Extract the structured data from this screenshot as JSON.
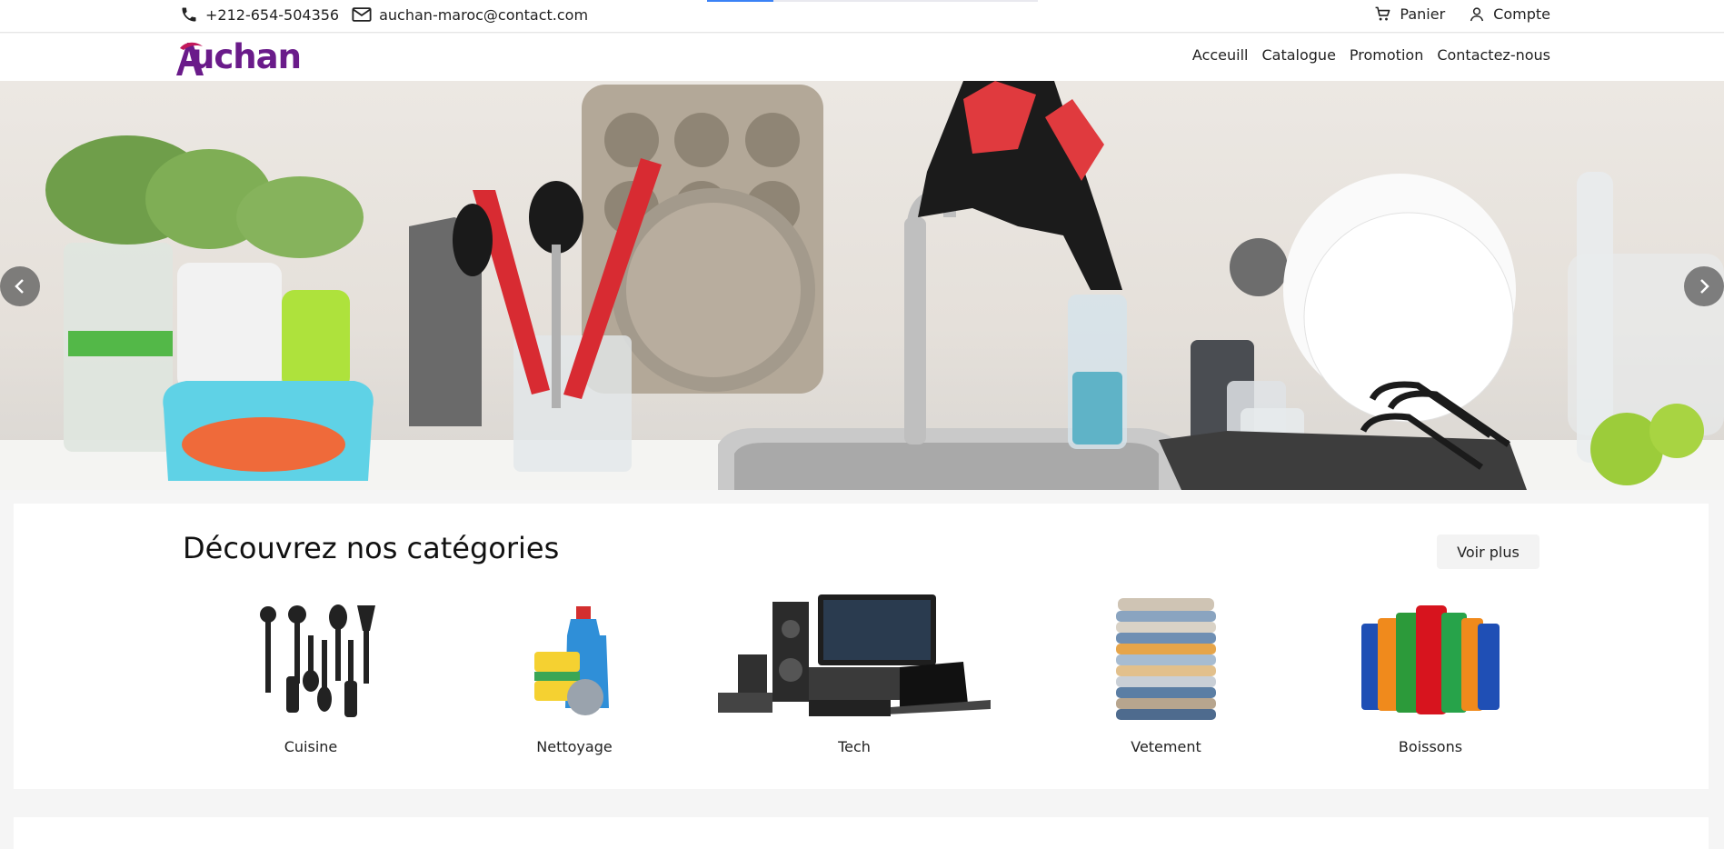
{
  "topbar": {
    "phone": "+212-654-504356",
    "email": "auchan-maroc@contact.com",
    "cart_label": "Panier",
    "account_label": "Compte",
    "progress": 0.2
  },
  "brand": {
    "logo_text": "Auchan",
    "color": "#6a1b8a"
  },
  "nav": {
    "items": [
      "Acceuill",
      "Catalogue",
      "Promotion",
      "Contactez-nous"
    ]
  },
  "hero": {
    "alt": "kitchen"
  },
  "categories": {
    "title": "Découvrez nos catégories",
    "more_label": "Voir plus",
    "items": [
      {
        "label": "Cuisine",
        "icon": "kitchen-utensils-icon"
      },
      {
        "label": "Nettoyage",
        "icon": "cleaning-products-icon"
      },
      {
        "label": "Tech",
        "icon": "electronics-icon"
      },
      {
        "label": "Vetement",
        "icon": "clothes-stack-icon"
      },
      {
        "label": "Boissons",
        "icon": "soda-cans-icon"
      }
    ]
  }
}
